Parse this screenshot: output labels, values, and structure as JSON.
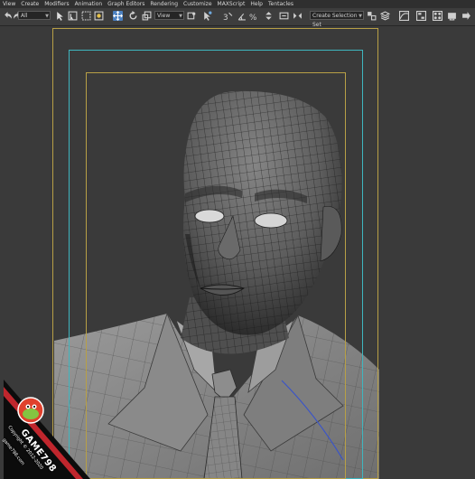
{
  "menu": [
    "View",
    "Create",
    "Modifiers",
    "Animation",
    "Graph Editors",
    "Rendering",
    "Customize",
    "MAXScript",
    "Help",
    "Tentacles"
  ],
  "toolbar": {
    "selection_filter": "All",
    "reference_coord": "View",
    "named_selection_set": "Create Selection Set",
    "icons": [
      "undo-icon",
      "redo-icon",
      "select-object-icon",
      "select-by-name-icon",
      "rectangular-selection-icon",
      "window-crossing-icon",
      "select-move-icon",
      "select-rotate-icon",
      "select-scale-icon",
      "pivot-center-icon",
      "select-manipulate-icon",
      "snaps-toggle-icon",
      "angle-snap-icon",
      "percent-snap-icon",
      "spinner-snap-icon",
      "edit-named-sets-icon",
      "mirror-icon",
      "align-icon",
      "layer-manager-icon",
      "curve-editor-icon",
      "schematic-view-icon",
      "material-editor-icon",
      "render-setup-icon",
      "render-icon"
    ]
  },
  "viewport": {
    "safe_frame_colors": {
      "outer": "#b8a046",
      "action": "#3fb6bf",
      "title": "#b8a046"
    }
  },
  "watermark": {
    "brand": "GAME798",
    "copyright": "Copyright © 2012-2020",
    "site": "game798.com"
  }
}
